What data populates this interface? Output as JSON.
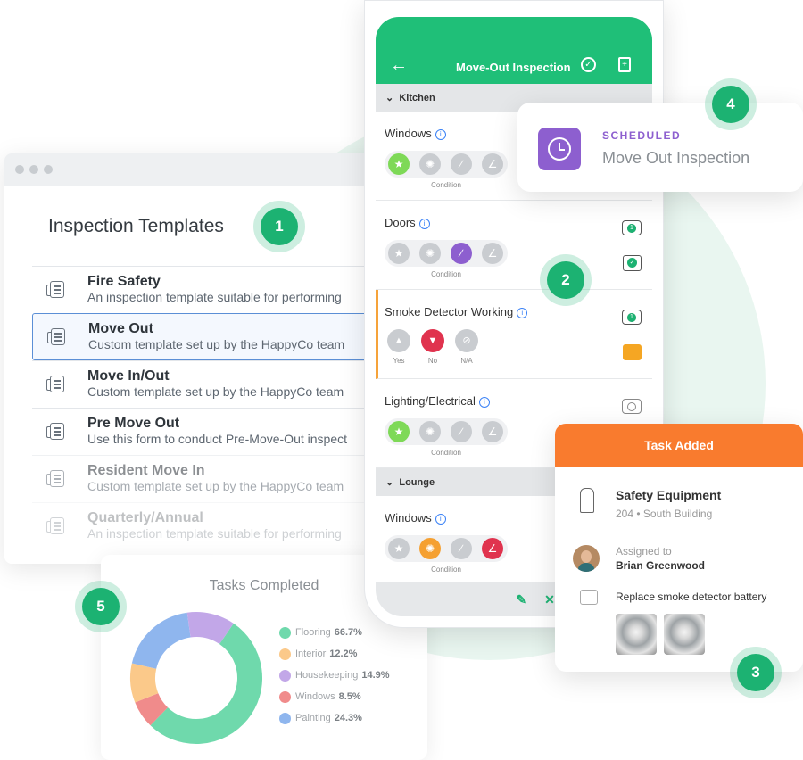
{
  "templates_window": {
    "title": "Inspection Templates",
    "items": [
      {
        "name": "Fire Safety",
        "desc": "An inspection template suitable for performing"
      },
      {
        "name": "Move Out",
        "desc": "Custom template set up by the HappyCo team"
      },
      {
        "name": "Move In/Out",
        "desc": "Custom template set up by the HappyCo team"
      },
      {
        "name": "Pre Move Out",
        "desc": "Use this form to conduct Pre-Move-Out inspect"
      },
      {
        "name": "Resident Move In",
        "desc": "Custom template set up by the HappyCo team"
      },
      {
        "name": "Quarterly/Annual",
        "desc": "An inspection template suitable for performing"
      }
    ]
  },
  "badges": [
    "1",
    "2",
    "3",
    "4",
    "5"
  ],
  "phone": {
    "title": "Move-Out Inspection",
    "sections": [
      "Kitchen",
      "Lounge"
    ],
    "items": [
      {
        "label": "Windows",
        "caption": "Condition"
      },
      {
        "label": "Doors",
        "caption": "Condition"
      },
      {
        "label": "Smoke Detector Working",
        "options": [
          "Yes",
          "No",
          "N/A"
        ]
      },
      {
        "label": "Lighting/Electrical",
        "caption": "Condition"
      },
      {
        "label": "Windows",
        "caption": "Condition"
      }
    ],
    "counts": [
      "1",
      "1",
      "1"
    ]
  },
  "scheduled": {
    "tag": "SCHEDULED",
    "title": "Move Out Inspection"
  },
  "task": {
    "header": "Task Added",
    "name": "Safety Equipment",
    "location": "204 • South Building",
    "assigned_label": "Assigned to",
    "assignee": "Brian Greenwood",
    "note": "Replace smoke detector battery"
  },
  "colors": {
    "green": "#1cb272",
    "purple": "#8d5fcf",
    "orange": "#f97b2e"
  },
  "chart_data": {
    "type": "pie",
    "title": "Tasks Completed",
    "slices": [
      {
        "label": "Flooring",
        "value": "66.7%",
        "pct": 66.7,
        "color": "#6fd9ac"
      },
      {
        "label": "Interior",
        "value": "12.2%",
        "pct": 12.2,
        "color": "#fbc98a"
      },
      {
        "label": "Housekeeping",
        "value": "14.9%",
        "pct": 14.9,
        "color": "#c2a7e8"
      },
      {
        "label": "Windows",
        "value": "8.5%",
        "pct": 8.5,
        "color": "#f08b8b"
      },
      {
        "label": "Painting",
        "value": "24.3%",
        "pct": 24.3,
        "color": "#8fb6ee"
      }
    ]
  }
}
